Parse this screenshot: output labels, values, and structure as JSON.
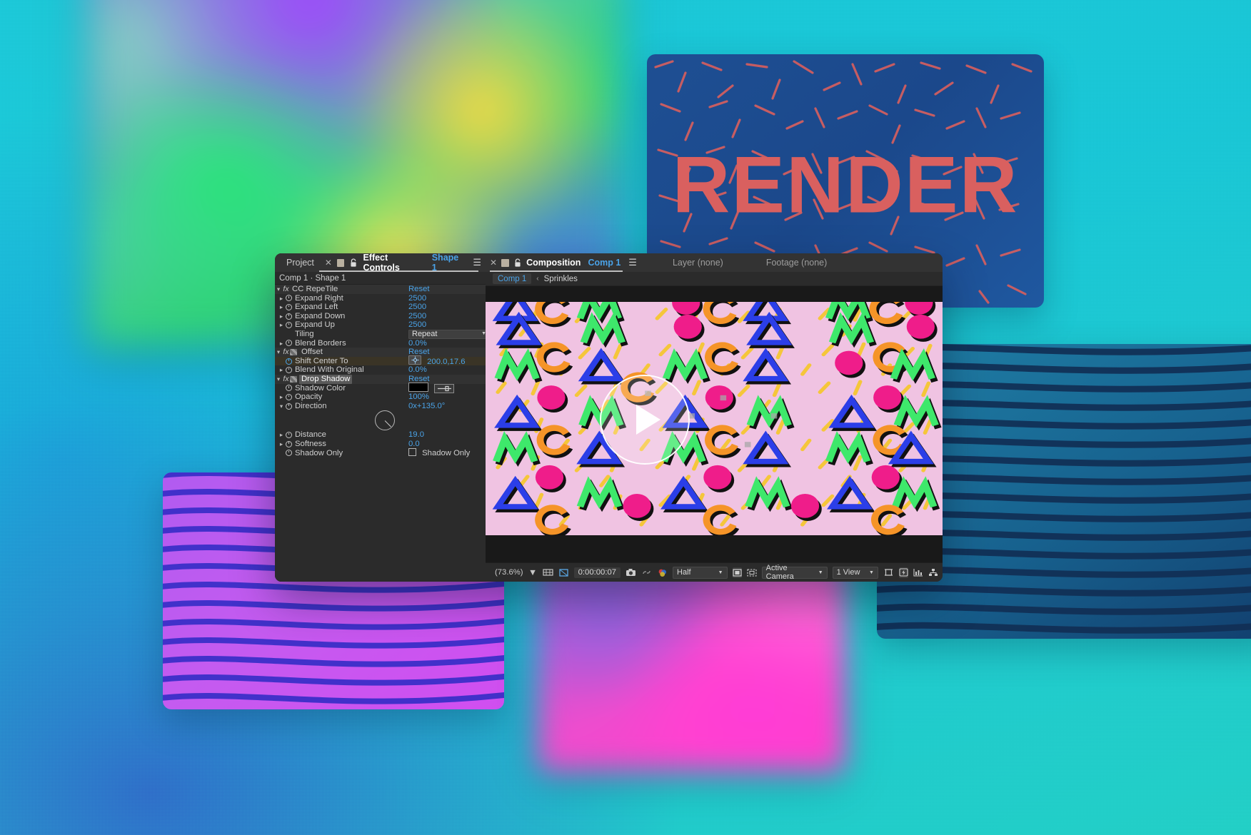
{
  "app": {
    "panels": {
      "effect_controls": {
        "inactive_tab": "Project",
        "close_icon": "close-icon",
        "comp_icon": "composition-thumb-icon",
        "lock_icon": "lock-icon",
        "title": "Effect Controls",
        "subject": "Shape 1",
        "menu_icon": "panel-menu-icon",
        "breadcrumb": "Comp 1 · Shape 1",
        "effects": [
          {
            "name": "CC RepeTile",
            "reset": "Reset",
            "properties": [
              {
                "label": "Expand Right",
                "value": "2500",
                "type": "number"
              },
              {
                "label": "Expand Left",
                "value": "2500",
                "type": "number"
              },
              {
                "label": "Expand Down",
                "value": "2500",
                "type": "number"
              },
              {
                "label": "Expand Up",
                "value": "2500",
                "type": "number"
              },
              {
                "label": "Tiling",
                "value": "Repeat",
                "type": "dropdown"
              },
              {
                "label": "Blend Borders",
                "value": "0.0%",
                "type": "number"
              }
            ]
          },
          {
            "name": "Offset",
            "reset": "Reset",
            "properties": [
              {
                "label": "Shift Center To",
                "value": "200.0,17.6",
                "type": "point"
              },
              {
                "label": "Blend With Original",
                "value": "0.0%",
                "type": "number"
              }
            ]
          },
          {
            "name": "Drop Shadow",
            "reset": "Reset",
            "properties": [
              {
                "label": "Shadow Color",
                "value": "#000000",
                "type": "color"
              },
              {
                "label": "Opacity",
                "value": "100%",
                "type": "number"
              },
              {
                "label": "Direction",
                "value": "0x+135.0°",
                "type": "angle"
              },
              {
                "label": "Distance",
                "value": "19.0",
                "type": "number"
              },
              {
                "label": "Softness",
                "value": "0.0",
                "type": "number"
              },
              {
                "label": "Shadow Only",
                "value": "Shadow Only",
                "type": "checkbox"
              }
            ]
          }
        ]
      },
      "composition": {
        "close_icon": "close-icon",
        "comp_icon": "composition-thumb-icon",
        "lock_icon": "lock-icon",
        "title": "Composition",
        "subject": "Comp 1",
        "menu_icon": "panel-menu-icon",
        "viewer_tabs": [
          "Layer (none)",
          "Footage (none)"
        ],
        "breadcrumb": {
          "active": "Comp 1",
          "separator": "‹",
          "item": "Sprinkles"
        },
        "overlay_play_icon": "play-button-icon",
        "toolbar": {
          "zoom": "(73.6%)",
          "grid_icon": "choose-grid-guide-icon",
          "mask_icon": "region-of-interest-icon",
          "timecode": "0:00:00:07",
          "snapshot_icon": "take-snapshot-icon",
          "show_snapshot_icon": "show-snapshot-icon",
          "channels_icon": "show-channel-icon",
          "resolution": "Half",
          "toggle_transparency_icon": "toggle-transparency-grid-icon",
          "region_icon": "region-of-interest-box-icon",
          "camera": "Active Camera",
          "views": "1 View",
          "pixel_aspect_icon": "pixel-aspect-correction-icon",
          "fast_preview_icon": "fast-previews-icon",
          "timeline_icon": "timeline-icon",
          "flowchart_icon": "comp-flowchart-icon"
        }
      }
    }
  },
  "canvas": {
    "name": "sprinkles-pattern",
    "background_color": "#f0c3e2",
    "colors": {
      "blue": "#2b3ee8",
      "green": "#3ee86b",
      "pink": "#ef1d8a",
      "orange": "#f59428",
      "yellow": "#f5c63a",
      "shadow": "#111111"
    }
  },
  "background_cards": [
    {
      "name": "gradient-card",
      "label": "blurred gradient"
    },
    {
      "name": "render-card",
      "label": "RENDER",
      "bg": "#1e4f93",
      "fg": "#d9605f"
    },
    {
      "name": "teal-stripes-card",
      "label": "wavy teal stripes",
      "bg": "#17618e"
    },
    {
      "name": "purple-stripes-card",
      "label": "wavy purple stripes",
      "bg": "#c45bf0"
    },
    {
      "name": "pink-gradient-card",
      "label": "blurred pink gradient"
    }
  ]
}
